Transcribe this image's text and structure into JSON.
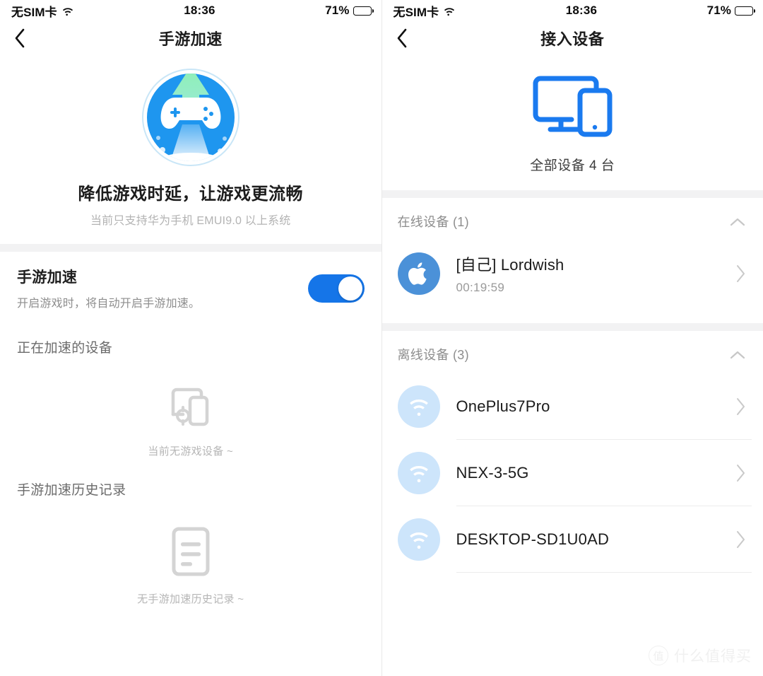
{
  "status_bar": {
    "carrier": "无SIM卡",
    "wifi_icon": "wifi-icon",
    "time": "18:36",
    "battery_percent": "71%",
    "battery_icon": "battery-icon"
  },
  "colors": {
    "accent_blue": "#1575e8",
    "icon_blue": "#1a7aef",
    "apple_avatar_blue": "#4b91d8",
    "wifi_avatar_blue": "#cde5fb",
    "band_gray": "#f2f2f3",
    "muted_text": "#8e8e8e"
  },
  "left_panel": {
    "back_icon": "chevron-left-icon",
    "title": "手游加速",
    "hero": {
      "icon": "game-boost-icon",
      "headline": "降低游戏时延，让游戏更流畅",
      "subline": "当前只支持华为手机 EMUI9.0 以上系统"
    },
    "toggle_row": {
      "title": "手游加速",
      "desc": "开启游戏时，将自动开启手游加速。",
      "toggle_state": "on"
    },
    "accelerating_section": {
      "heading": "正在加速的设备",
      "empty_icon": "devices-empty-icon",
      "empty_text": "当前无游戏设备 ~"
    },
    "history_section": {
      "heading": "手游加速历史记录",
      "empty_icon": "document-empty-icon",
      "empty_text": "无手游加速历史记录 ~"
    }
  },
  "right_panel": {
    "back_icon": "chevron-left-icon",
    "title": "接入设备",
    "hero": {
      "icon": "monitor-phone-icon",
      "caption": "全部设备 4 台"
    },
    "groups": [
      {
        "title": "在线设备 (1)",
        "collapse_icon": "chevron-up-icon",
        "devices": [
          {
            "avatar_icon": "apple-icon",
            "avatar_type": "apple",
            "name": "[自己] Lordwish",
            "sub": "00:19:59",
            "chevron_icon": "chevron-right-icon",
            "divider": false
          }
        ]
      },
      {
        "title": "离线设备 (3)",
        "collapse_icon": "chevron-up-icon",
        "devices": [
          {
            "avatar_icon": "wifi-icon",
            "avatar_type": "wifi",
            "name": "OnePlus7Pro",
            "sub": "",
            "chevron_icon": "chevron-right-icon",
            "divider": true
          },
          {
            "avatar_icon": "wifi-icon",
            "avatar_type": "wifi",
            "name": "NEX-3-5G",
            "sub": "",
            "chevron_icon": "chevron-right-icon",
            "divider": true
          },
          {
            "avatar_icon": "wifi-icon",
            "avatar_type": "wifi",
            "name": "DESKTOP-SD1U0AD",
            "sub": "",
            "chevron_icon": "chevron-right-icon",
            "divider": true
          }
        ]
      }
    ],
    "watermark": {
      "badge": "值",
      "text": "什么值得买"
    }
  }
}
